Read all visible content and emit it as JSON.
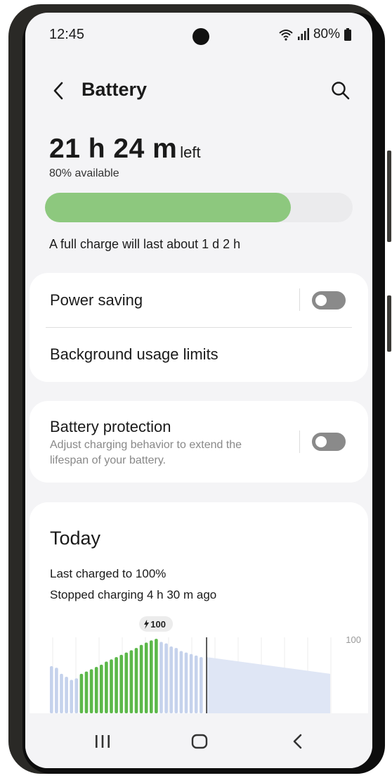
{
  "status_bar": {
    "time": "12:45",
    "battery_percent": "80%"
  },
  "header": {
    "title": "Battery"
  },
  "summary": {
    "time_left": "21 h 24 m",
    "time_left_suffix": "left",
    "available": "80% available",
    "level_percent": 80,
    "full_charge_text": "A full charge will last about 1 d 2 h"
  },
  "settings": {
    "power_saving_label": "Power saving",
    "power_saving_on": false,
    "background_limits_label": "Background usage limits",
    "battery_protection_label": "Battery protection",
    "battery_protection_desc": "Adjust charging behavior to extend the lifespan of your battery.",
    "battery_protection_on": false
  },
  "today": {
    "title": "Today",
    "last_charged": "Last charged to 100%",
    "stopped": "Stopped charging 4 h 30 m ago",
    "peak_badge": "100",
    "y_max_label": "100"
  },
  "chart_data": {
    "type": "bar",
    "y_max": 100,
    "values": [
      62,
      60,
      52,
      48,
      44,
      46,
      52,
      55,
      58,
      61,
      64,
      68,
      71,
      74,
      77,
      80,
      83,
      86,
      90,
      93,
      96,
      98,
      94,
      92,
      88,
      86,
      82,
      80,
      78,
      76,
      74
    ],
    "charging_start_index": 6,
    "charging_end_index": 21,
    "now_index": 31,
    "projection": {
      "start": 74,
      "end": 52
    }
  },
  "colors": {
    "accent_green": "#8dc87e",
    "bar_charging": "#5cb84a",
    "bar_discharge": "#c5d2ec",
    "projection_fill": "#dfe6f5"
  },
  "nav": {
    "recents_icon": "recents-icon",
    "home_icon": "home-icon",
    "back_icon": "back-icon"
  }
}
